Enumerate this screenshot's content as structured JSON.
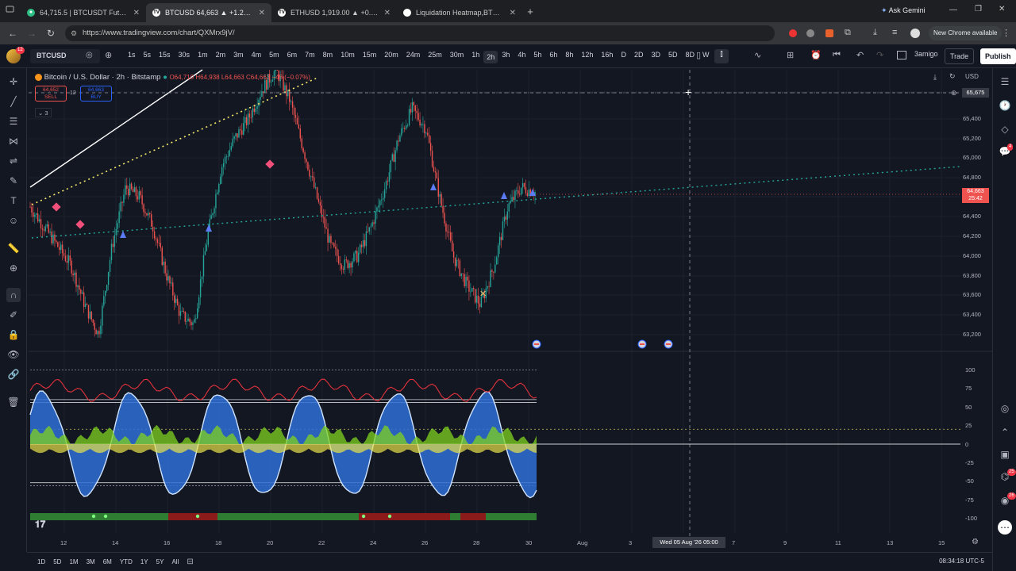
{
  "browser": {
    "tabs": [
      {
        "label": "64,715.5 | BTCUSDT Futures Exch",
        "active": false,
        "fav_color": "#2ebd85"
      },
      {
        "label": "BTCUSD 64,663 ▲ +1.2% 3amig",
        "active": true,
        "fav_color": "#131722"
      },
      {
        "label": "ETHUSD 1,919.00 ▲ +0.55% 3a",
        "active": false,
        "fav_color": "#131722"
      },
      {
        "label": "Liquidation Heatmap,BTC Liquid",
        "active": false,
        "fav_color": "#ffffff"
      }
    ],
    "ask_gemini": "Ask Gemini",
    "url": "https://www.tradingview.com/chart/QXMrx9jV/",
    "new_chrome": "New Chrome available"
  },
  "toolbar": {
    "symbol": "BTCUSD",
    "avatar_badge": "12",
    "timeframes": [
      "1s",
      "5s",
      "15s",
      "30s",
      "1m",
      "2m",
      "3m",
      "4m",
      "5m",
      "6m",
      "7m",
      "8m",
      "10m",
      "15m",
      "20m",
      "24m",
      "25m",
      "30m",
      "1h",
      "2h",
      "3h",
      "4h",
      "5h",
      "6h",
      "8h",
      "12h",
      "16h",
      "D",
      "2D",
      "3D",
      "5D",
      "8D",
      "W",
      "2W"
    ],
    "selected_tf": "2h",
    "user": "3amigo",
    "trade": "Trade",
    "publish": "Publish"
  },
  "legend": {
    "title": "Bitcoin / U.S. Dollar · 2h · Bitstamp",
    "ohlc": "O64,710 H64,938 L64,663 C64,663 −45 (−0.07%)",
    "sell_price": "64,652",
    "sell_label": "SELL",
    "spread": "12",
    "buy_price": "64,663",
    "buy_label": "BUY",
    "indicators_count": "3"
  },
  "price_scale": {
    "currency": "USD",
    "ticks": [
      "65,675",
      "65,400",
      "65,200",
      "65,000",
      "64,800",
      "64,600",
      "64,400",
      "64,200",
      "64,000",
      "63,800",
      "63,600",
      "63,400",
      "63,200"
    ],
    "crosshair_price": "65,675",
    "last_price": "64,663",
    "countdown": "25:42"
  },
  "osc_scale": {
    "ticks": [
      "100",
      "75",
      "50",
      "25",
      "0",
      "-25",
      "-50",
      "-75",
      "-100"
    ]
  },
  "time_axis": {
    "ticks": [
      "12",
      "14",
      "16",
      "18",
      "20",
      "22",
      "24",
      "26",
      "28",
      "30",
      "Aug",
      "3",
      "7",
      "9",
      "11",
      "13",
      "15"
    ],
    "crosshair_label": "Wed 05 Aug '26   05:00"
  },
  "bottom": {
    "ranges": [
      "1D",
      "5D",
      "1M",
      "3M",
      "6M",
      "YTD",
      "1Y",
      "5Y",
      "All"
    ],
    "clock": "08:34:18 UTC-5"
  },
  "colors": {
    "bg": "#131722",
    "up": "#26a69a",
    "down": "#ef5350",
    "accent": "#2962ff"
  }
}
